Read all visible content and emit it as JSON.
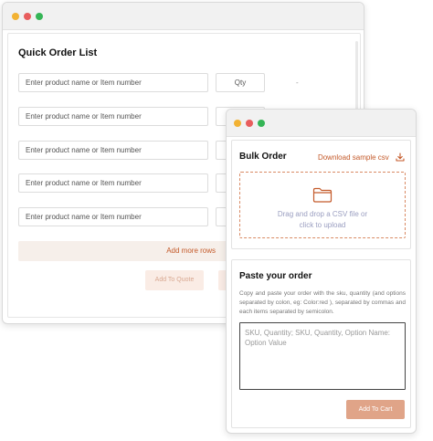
{
  "quick_order": {
    "title": "Quick Order List",
    "rows": [
      {
        "placeholder": "Enter product name or Item number",
        "qty": "Qty",
        "dash": "-"
      },
      {
        "placeholder": "Enter product name or Item number"
      },
      {
        "placeholder": "Enter product name or Item number"
      },
      {
        "placeholder": "Enter product name or Item number"
      },
      {
        "placeholder": "Enter product name or Item number"
      }
    ],
    "add_more_rows": "Add more rows",
    "add_to_quote": "Add To Quote"
  },
  "bulk_order": {
    "title": "Bulk Order",
    "download_label": "Download sample csv",
    "dropzone_line1": "Drag and drop a CSV file or",
    "dropzone_line2": "click to upload"
  },
  "paste_order": {
    "title": "Paste your order",
    "description": "Copy and paste your order with the sku, quantity (and options separated by colon, eg: Color:red ), separated by commas and each items separated by semicolon.",
    "textarea_placeholder": "SKU, Quantity; SKU, Quantity, Option Name: Option Value",
    "add_to_cart": "Add To Cart"
  },
  "colors": {
    "accent": "#c45a2a",
    "button_bg": "#e0a488",
    "light_accent_bg": "#f6efea",
    "dot_yellow": "#f2b233",
    "dot_red": "#e85d5d",
    "dot_green": "#35b556"
  }
}
